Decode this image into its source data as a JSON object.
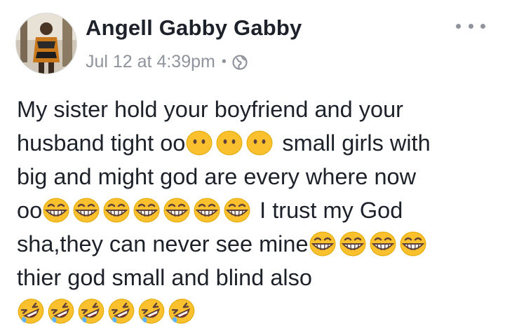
{
  "post": {
    "author": "Angell Gabby Gabby",
    "time": "Jul 12 at 4:39pm",
    "separator": "•",
    "privacy_icon": "globe-icon",
    "menu_icon": "more-options-icon",
    "lines": [
      {
        "text": "My sister hold your boyfriend and your",
        "emoji": [],
        "after_text": ""
      },
      {
        "text": "husband tight oo",
        "emoji": [
          "neutral-face-icon",
          "neutral-face-icon",
          "neutral-face-icon"
        ],
        "after_text": " small girls with"
      },
      {
        "text": "big and might god are every where now",
        "emoji": [],
        "after_text": ""
      },
      {
        "text": "oo",
        "emoji": [
          "grinning-face-icon",
          "grinning-face-icon",
          "grinning-face-icon",
          "grinning-face-icon",
          "grinning-face-icon",
          "grinning-face-icon",
          "grinning-face-icon"
        ],
        "after_text": " I trust my God"
      },
      {
        "text": "sha,they can never see mine",
        "emoji": [
          "grinning-face-icon",
          "grinning-face-icon",
          "grinning-face-icon",
          "grinning-face-icon"
        ],
        "after_text": ""
      },
      {
        "text": "thier god small and blind also",
        "emoji": [],
        "after_text": ""
      },
      {
        "text": "",
        "emoji": [
          "rolling-laughing-icon",
          "rolling-laughing-icon",
          "rolling-laughing-icon",
          "rolling-laughing-icon",
          "rolling-laughing-icon",
          "rolling-laughing-icon"
        ],
        "after_text": ""
      }
    ]
  },
  "colors": {
    "name": "#1d2129",
    "meta": "#90949c",
    "body_text": "#1d2129",
    "emoji_yellow": "#fbc02d",
    "emoji_dark": "#5d4037"
  }
}
